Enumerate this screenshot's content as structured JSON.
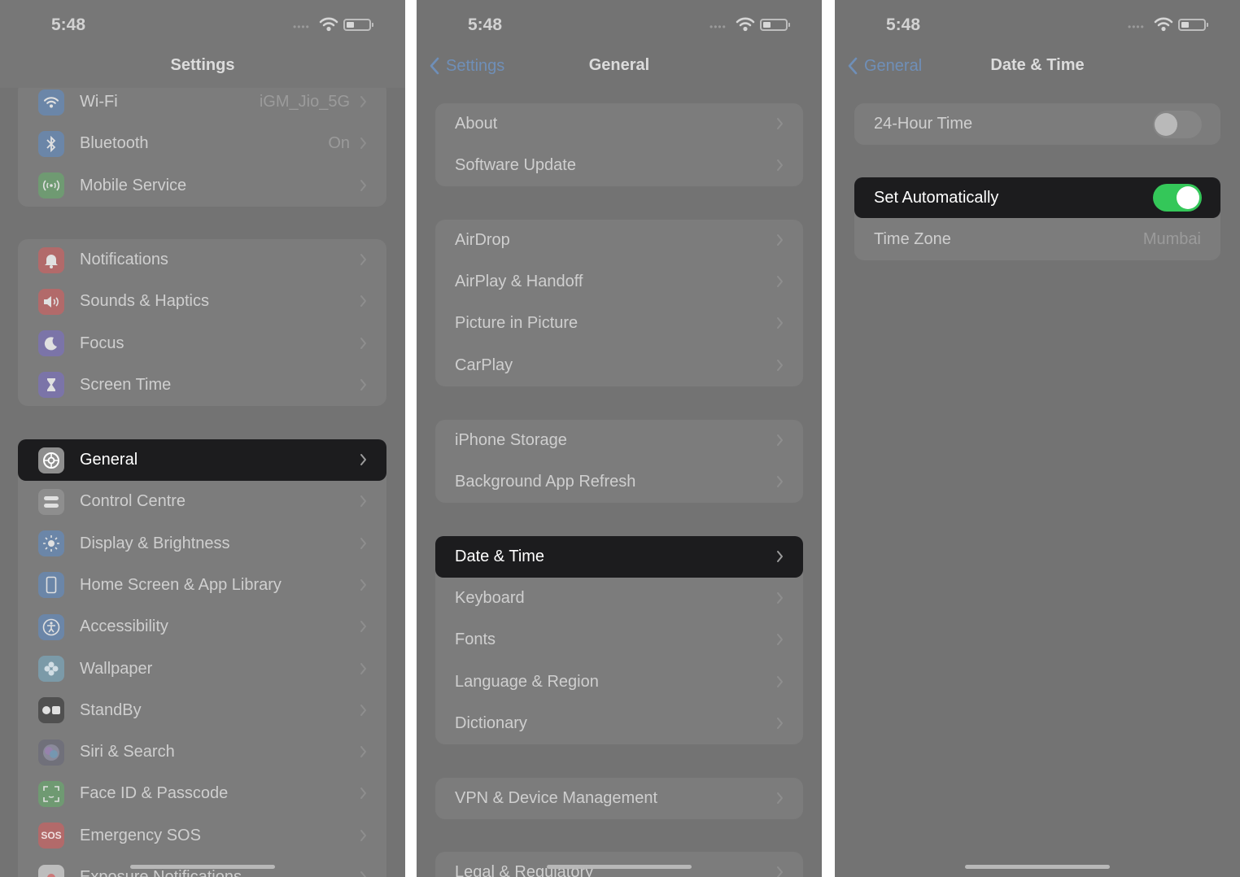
{
  "status_time": "5:48",
  "colors": {
    "panel_bg": "#737373",
    "row_bg": "#7c7c7c",
    "selected_row_bg": "#1c1c1e",
    "toggle_on": "#34c759",
    "link_blue": "#6f8fb8"
  },
  "settings_screen": {
    "title": "Settings",
    "groups": [
      [
        {
          "label": "Wi-Fi",
          "value": "iGM_Jio_5G",
          "icon": "wifi-icon",
          "color": "#6b86a8"
        },
        {
          "label": "Bluetooth",
          "value": "On",
          "icon": "bluetooth-icon",
          "color": "#6b86a8"
        },
        {
          "label": "Mobile Service",
          "value": "",
          "icon": "antenna-icon",
          "color": "#6f9a72"
        }
      ],
      [
        {
          "label": "Notifications",
          "value": "",
          "icon": "bell-icon",
          "color": "#b26a6a"
        },
        {
          "label": "Sounds & Haptics",
          "value": "",
          "icon": "speaker-icon",
          "color": "#b26a6a"
        },
        {
          "label": "Focus",
          "value": "",
          "icon": "moon-icon",
          "color": "#7b74a8"
        },
        {
          "label": "Screen Time",
          "value": "",
          "icon": "hourglass-icon",
          "color": "#7b74a8"
        }
      ],
      [
        {
          "label": "General",
          "value": "",
          "icon": "gear-icon",
          "color": "#8e8e8e",
          "selected": true
        },
        {
          "label": "Control Centre",
          "value": "",
          "icon": "switches-icon",
          "color": "#8e8e8e"
        },
        {
          "label": "Display & Brightness",
          "value": "",
          "icon": "sun-icon",
          "color": "#6b86a8"
        },
        {
          "label": "Home Screen & App Library",
          "value": "",
          "icon": "phone-grid-icon",
          "color": "#6b86a8"
        },
        {
          "label": "Accessibility",
          "value": "",
          "icon": "accessibility-icon",
          "color": "#6b86a8"
        },
        {
          "label": "Wallpaper",
          "value": "",
          "icon": "flower-icon",
          "color": "#7b9aa8"
        },
        {
          "label": "StandBy",
          "value": "",
          "icon": "standby-icon",
          "color": "#505050"
        },
        {
          "label": "Siri & Search",
          "value": "",
          "icon": "siri-icon",
          "color": "#70707a"
        },
        {
          "label": "Face ID & Passcode",
          "value": "",
          "icon": "face-id-icon",
          "color": "#6f9a72"
        },
        {
          "label": "Emergency SOS",
          "value": "",
          "icon": "sos-icon",
          "color": "#b26a6a",
          "text": "SOS"
        },
        {
          "label": "Exposure Notifications",
          "value": "",
          "icon": "exposure-icon",
          "color": "#bdbdbd"
        }
      ]
    ]
  },
  "general_screen": {
    "back_label": "Settings",
    "title": "General",
    "groups": [
      [
        {
          "label": "About"
        },
        {
          "label": "Software Update"
        }
      ],
      [
        {
          "label": "AirDrop"
        },
        {
          "label": "AirPlay & Handoff"
        },
        {
          "label": "Picture in Picture"
        },
        {
          "label": "CarPlay"
        }
      ],
      [
        {
          "label": "iPhone Storage"
        },
        {
          "label": "Background App Refresh"
        }
      ],
      [
        {
          "label": "Date & Time",
          "selected": true
        },
        {
          "label": "Keyboard"
        },
        {
          "label": "Fonts"
        },
        {
          "label": "Language & Region"
        },
        {
          "label": "Dictionary"
        }
      ],
      [
        {
          "label": "VPN & Device Management"
        }
      ],
      [
        {
          "label": "Legal & Regulatory"
        }
      ]
    ]
  },
  "datetime_screen": {
    "back_label": "General",
    "title": "Date & Time",
    "hour24": {
      "label": "24-Hour Time",
      "on": false
    },
    "set_automatically": {
      "label": "Set Automatically",
      "on": true
    },
    "time_zone": {
      "label": "Time Zone",
      "value": "Mumbai"
    }
  }
}
